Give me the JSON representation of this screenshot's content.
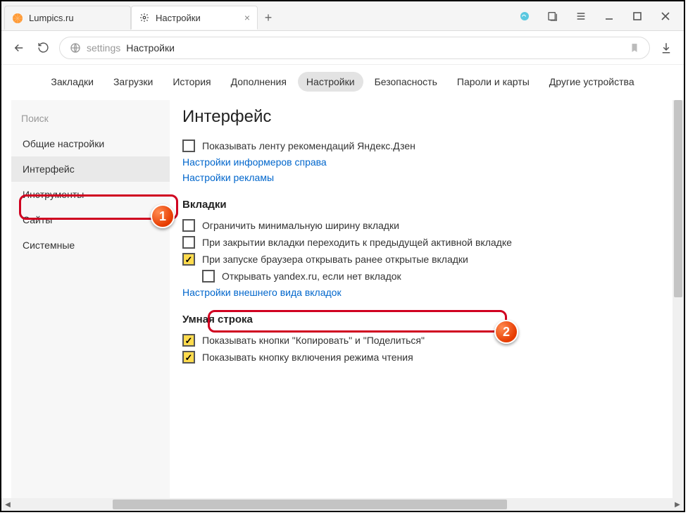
{
  "tabs": [
    {
      "title": "Lumpics.ru",
      "active": false
    },
    {
      "title": "Настройки",
      "active": true
    }
  ],
  "address": {
    "context": "settings",
    "title": "Настройки"
  },
  "topnav": {
    "items": [
      "Закладки",
      "Загрузки",
      "История",
      "Дополнения",
      "Настройки",
      "Безопасность",
      "Пароли и карты",
      "Другие устройства"
    ],
    "selected": 4
  },
  "sidebar": {
    "search_placeholder": "Поиск",
    "items": [
      "Общие настройки",
      "Интерфейс",
      "Инструменты",
      "Сайты",
      "Системные"
    ],
    "selected": 1
  },
  "sections": {
    "interface": {
      "title": "Интерфейс",
      "zen_checkbox": "Показывать ленту рекомендаций Яндекс.Дзен",
      "link_informers": "Настройки информеров справа",
      "link_ads": "Настройки рекламы"
    },
    "tabs_section": {
      "title": "Вкладки",
      "limit_width": "Ограничить минимальную ширину вкладки",
      "close_prev": "При закрытии вкладки переходить к предыдущей активной вкладке",
      "restore": "При запуске браузера открывать ранее открытые вкладки",
      "open_yandex": "Открывать yandex.ru, если нет вкладок",
      "link_appearance": "Настройки внешнего вида вкладок"
    },
    "smartline": {
      "title": "Умная строка",
      "copy_share": "Показывать кнопки \"Копировать\" и \"Поделиться\"",
      "reader": "Показывать кнопку включения режима чтения"
    }
  },
  "callouts": {
    "one": "1",
    "two": "2"
  }
}
